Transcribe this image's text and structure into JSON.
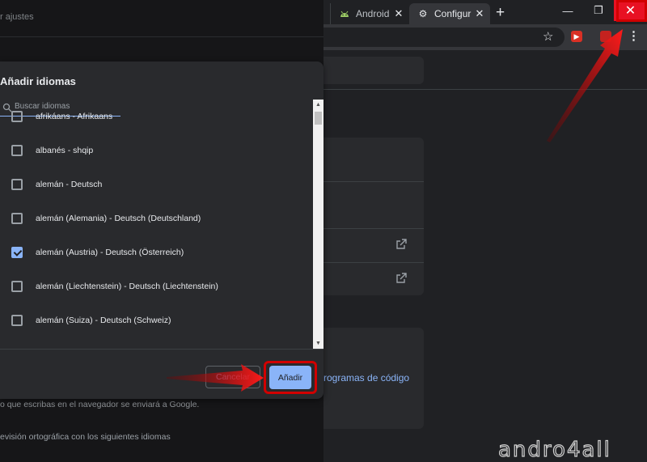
{
  "browser": {
    "tabs": [
      {
        "label": "Android",
        "icon": "android-icon"
      },
      {
        "label": "Configur",
        "icon": "gear-icon"
      }
    ],
    "new_tab": "+",
    "window_controls": {
      "minimize": "—",
      "maximize": "❐",
      "close": "✕"
    },
    "toolbar": {
      "bookmark": "☆",
      "menu": "⋮"
    }
  },
  "background": {
    "search_partial": "r ajustes",
    "link_partial": "rogramas de código",
    "footer_text_1": "o que escribas en el navegador se enviará a Google.",
    "footer_text_2": "evisión ortográfica con los siguientes idiomas"
  },
  "dialog": {
    "title": "Añadir idiomas",
    "search_placeholder": "Buscar idiomas",
    "languages": [
      {
        "label": "afrikáans - Afrikaans",
        "checked": false
      },
      {
        "label": "albanés - shqip",
        "checked": false
      },
      {
        "label": "alemán - Deutsch",
        "checked": false
      },
      {
        "label": "alemán (Alemania) - Deutsch (Deutschland)",
        "checked": false
      },
      {
        "label": "alemán (Austria) - Deutsch (Österreich)",
        "checked": true
      },
      {
        "label": "alemán (Liechtenstein) - Deutsch (Liechtenstein)",
        "checked": false
      },
      {
        "label": "alemán (Suiza) - Deutsch (Schweiz)",
        "checked": false
      }
    ],
    "cancel_label": "Cancelar",
    "add_label": "Añadir"
  },
  "watermark": "andro4all",
  "colors": {
    "accent": "#8ab4f8",
    "annotation_red": "#d10000",
    "close_red": "#e81123"
  }
}
